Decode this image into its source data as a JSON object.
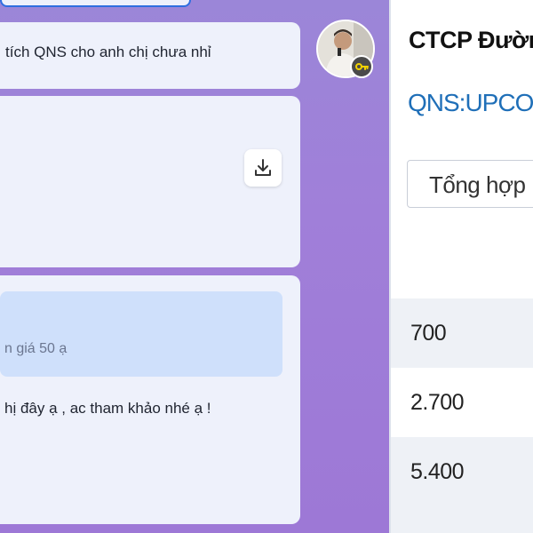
{
  "chat": {
    "messages": [
      {
        "text": "tích QNS cho anh chị chưa nhỉ"
      },
      {
        "attachment": {
          "icon": "download-icon"
        }
      },
      {
        "quote": "n giá 50 ạ",
        "text": "hị đây ạ , ac tham khảo nhé ạ !"
      }
    ],
    "avatar": {
      "badge_icon": "key-icon"
    }
  },
  "info_panel": {
    "company_name": "CTCP Đường",
    "ticker": "QNS:UPCOM",
    "tab_label": "Tổng hợp",
    "values": [
      "700",
      "2.700",
      "5.400"
    ]
  },
  "colors": {
    "chat_background": "#9d7fd8",
    "bubble": "#eef1fb",
    "quote": "#cfe0fb",
    "ticker": "#1f6fb8",
    "row_alt": "#eef1f6"
  }
}
